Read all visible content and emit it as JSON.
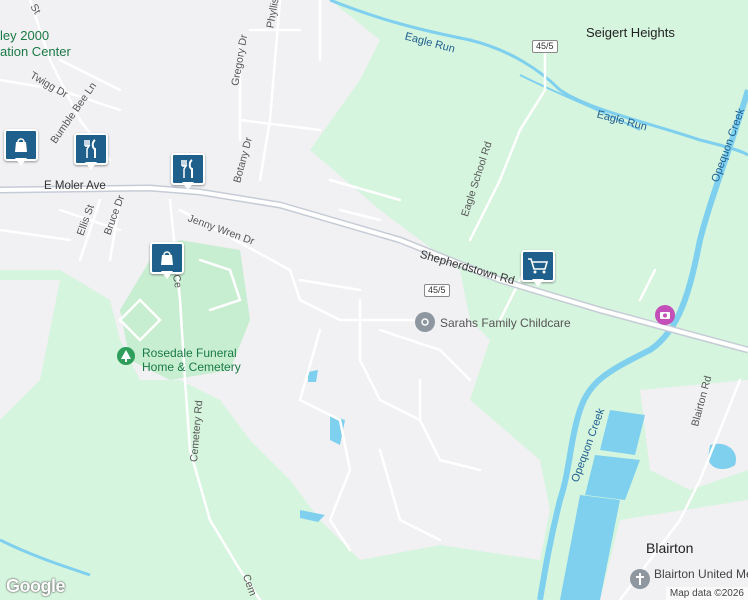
{
  "map": {
    "labels": {
      "place_seigert": "Seigert Heights",
      "place_blairton": "Blairton",
      "center_top": "ley 2000",
      "center_bottom": "ation Center",
      "street_st": "St",
      "street_phyllis": "Phyllis",
      "street_twigg": "Twigg Dr",
      "street_bumble": "Bumble Bee Ln",
      "street_gregory": "Gregory Dr",
      "street_botany": "Botany Dr",
      "street_moler": "E Moler Ave",
      "street_ellis": "Ellis St",
      "street_bruce": "Bruce Dr",
      "street_jenny": "Jenny Wren Dr",
      "street_ce": "Ce",
      "street_cemetery": "Cemetery Rd",
      "street_cem_bottom": "Cem",
      "street_eagle_school": "Eagle School Rd",
      "street_shepherdstown": "Shepherdstown Rd",
      "street_blairton_rd": "Blairton Rd",
      "water_eagle_run_1": "Eagle Run",
      "water_eagle_run_2": "Eagle Run",
      "water_opequon_1": "Opequon Creek",
      "water_opequon_2": "Opequon Creek",
      "route_1": "45/5",
      "route_2": "45/5",
      "poi_childcare": "Sarahs Family Childcare",
      "poi_funeral": "Rosedale Funeral Home & Cemetery",
      "poi_funeral_line1": "Rosedale Funeral",
      "poi_funeral_line2": "Home & Cemetery",
      "poi_church": "Blairton United Methodist Ch",
      "logo": "Google",
      "attribution": "Map data ©2026"
    },
    "markers": [
      {
        "type": "shopping-bag-icon"
      },
      {
        "type": "restaurant-icon"
      },
      {
        "type": "restaurant-icon"
      },
      {
        "type": "shopping-bag-icon"
      },
      {
        "type": "shopping-cart-icon"
      }
    ],
    "colors": {
      "land": "#d6f5de",
      "urban": "#f1f0f3",
      "water": "#7fd0ee",
      "road": "#ffffff",
      "highway": "#c6ccd6",
      "marker": "#1f5f8b"
    }
  }
}
